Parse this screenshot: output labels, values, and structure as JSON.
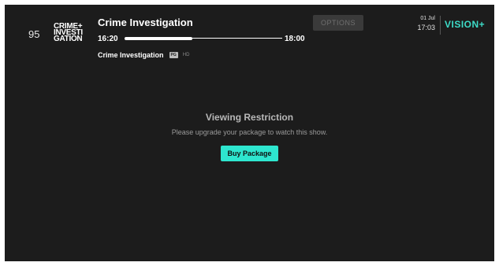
{
  "channel": {
    "number": "95",
    "logo_lines": [
      "CRIME+",
      "INVESTI",
      "GATION"
    ]
  },
  "program": {
    "title": "Crime Investigation",
    "start_time": "16:20",
    "end_time": "18:00",
    "progress": 0.43,
    "channel_name": "Crime Investigation",
    "rating": "PG",
    "quality": "HD"
  },
  "toolbar": {
    "options_label": "OPTIONS"
  },
  "status": {
    "date": "01 Jul",
    "time": "17:03",
    "brand": "VISION+"
  },
  "restriction": {
    "title": "Viewing Restriction",
    "message": "Please upgrade your package to watch this show.",
    "buy_label": "Buy Package"
  },
  "colors": {
    "accent": "#2ee6cf",
    "background": "#1c1c1c"
  }
}
